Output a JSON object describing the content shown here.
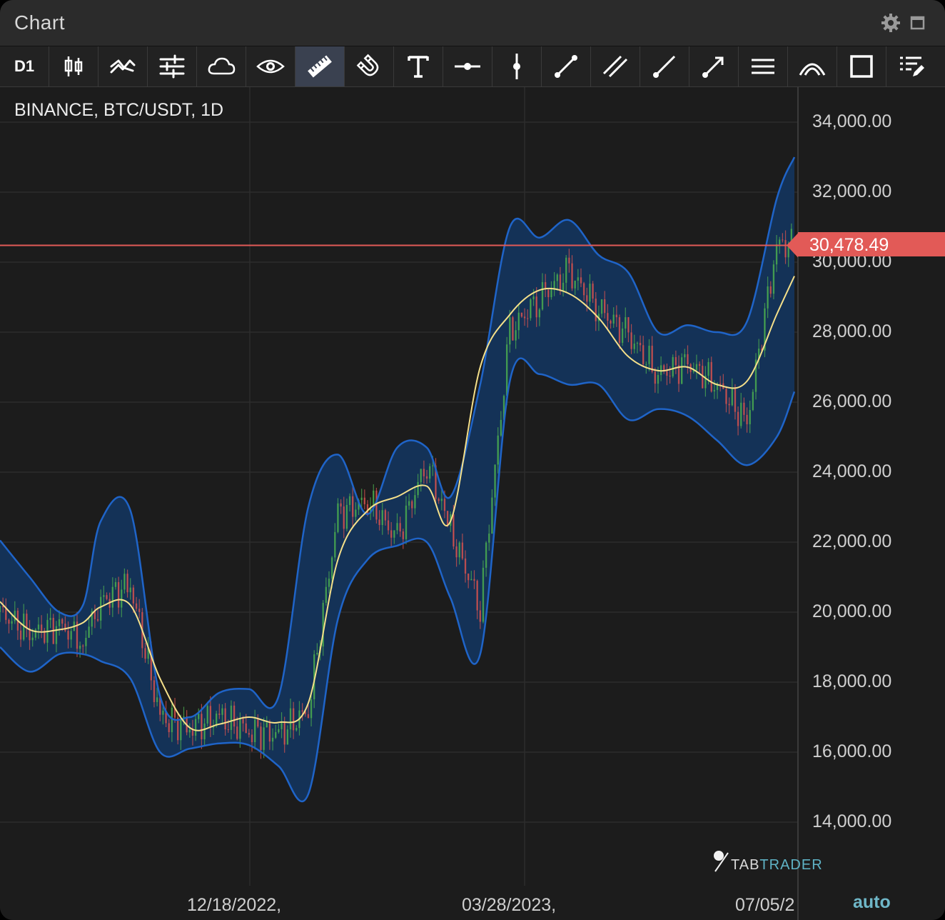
{
  "window": {
    "title": "Chart"
  },
  "toolbar": {
    "timeframe": "D1",
    "tools": [
      "candle-type-icon",
      "indicators-icon",
      "settings-sliders-icon",
      "cloud-icon",
      "eye-icon",
      "ruler-icon",
      "magnet-icon",
      "text-icon",
      "horizontal-ray-icon",
      "vertical-line-icon",
      "trend-line-icon",
      "parallel-channel-icon",
      "ray-line-icon",
      "arrow-line-icon",
      "horizontal-lines-icon",
      "arc-icon",
      "rectangle-icon",
      "drawings-list-icon"
    ],
    "active_tool": "ruler-icon"
  },
  "chart": {
    "symbol": "BINANCE, BTC/USDT, 1D",
    "last_price": "30,478.49",
    "scale_mode": "auto",
    "watermark": "TABTRADER",
    "colors": {
      "background": "#1c1c1c",
      "band": "#1f64c8",
      "band_fill": "#13345c",
      "ma": "#f5e08a",
      "up": "#4caf50",
      "down": "#d9534f",
      "price_line": "#e25a57"
    }
  },
  "chart_data": {
    "type": "line",
    "title": "BINANCE, BTC/USDT, 1D",
    "y_ticks": [
      "34,000.00",
      "32,000.00",
      "30,000.00",
      "28,000.00",
      "26,000.00",
      "24,000.00",
      "22,000.00",
      "20,000.00",
      "18,000.00",
      "16,000.00",
      "14,000.00"
    ],
    "x_ticks": [
      "12/18/2022,",
      "03/28/2023,",
      "07/05/2"
    ],
    "ylim": [
      12800,
      34500
    ],
    "current_price": 30478.49,
    "indicator": "Bollinger Bands",
    "x": [
      "2022-10-09",
      "2022-10-19",
      "2022-10-29",
      "2022-11-06",
      "2022-11-12",
      "2022-11-22",
      "2022-12-02",
      "2022-12-12",
      "2022-12-22",
      "2023-01-01",
      "2023-01-11",
      "2023-01-21",
      "2023-01-31",
      "2023-02-10",
      "2023-02-20",
      "2023-03-02",
      "2023-03-10",
      "2023-03-20",
      "2023-03-30",
      "2023-04-09",
      "2023-04-19",
      "2023-04-29",
      "2023-05-09",
      "2023-05-19",
      "2023-05-29",
      "2023-06-08",
      "2023-06-18",
      "2023-06-28",
      "2023-07-04"
    ],
    "series": [
      {
        "name": "Upper",
        "values": [
          22050,
          21000,
          20000,
          20200,
          22600,
          22900,
          17600,
          17000,
          17700,
          17800,
          17600,
          23000,
          24500,
          22800,
          24700,
          24700,
          23300,
          26500,
          31000,
          30700,
          31200,
          30200,
          29700,
          28000,
          28200,
          28000,
          28300,
          31800,
          33000
        ]
      },
      {
        "name": "Middle",
        "values": [
          20300,
          19500,
          19500,
          19700,
          20150,
          20200,
          18100,
          16700,
          16800,
          17000,
          16850,
          17400,
          21500,
          22900,
          23300,
          23600,
          22600,
          27000,
          28500,
          29200,
          29100,
          28400,
          27300,
          26900,
          27000,
          26500,
          26600,
          28500,
          29600
        ]
      },
      {
        "name": "Lower",
        "values": [
          19000,
          18300,
          18800,
          18800,
          18600,
          18100,
          16000,
          16100,
          16250,
          16200,
          15600,
          14800,
          19800,
          21500,
          21900,
          22000,
          20400,
          18800,
          26600,
          26800,
          26500,
          26500,
          25500,
          25800,
          25600,
          24900,
          24200,
          25000,
          26300
        ]
      }
    ],
    "close": [
      20000,
      19400,
      19600,
      19200,
      20300,
      20800,
      17000,
      16700,
      17000,
      16600,
      16500,
      17200,
      22800,
      23200,
      22100,
      24300,
      22300,
      20200,
      28000,
      29000,
      29700,
      28700,
      27900,
      26800,
      27100,
      26500,
      25400,
      30500,
      30478.49
    ]
  }
}
